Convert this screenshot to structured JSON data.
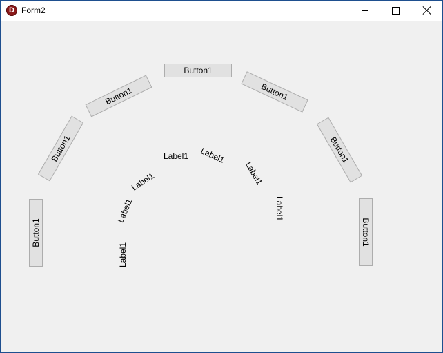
{
  "window": {
    "title": "Form2",
    "icon": "delphi-app-icon",
    "icon_glyph": "D",
    "icon_color": "#8b1a1a",
    "controls": [
      "minimize-icon",
      "maximize-icon",
      "close-icon"
    ]
  },
  "buttons": [
    {
      "label": "Button1"
    },
    {
      "label": "Button1"
    },
    {
      "label": "Button1"
    },
    {
      "label": "Button1"
    },
    {
      "label": "Button1"
    },
    {
      "label": "Button1"
    },
    {
      "label": "Button1"
    }
  ],
  "labels": [
    {
      "text": "Label1"
    },
    {
      "text": "Label1"
    },
    {
      "text": "Label1"
    },
    {
      "text": "Label1"
    },
    {
      "text": "Label1"
    },
    {
      "text": "Label1"
    },
    {
      "text": "Label1"
    }
  ]
}
